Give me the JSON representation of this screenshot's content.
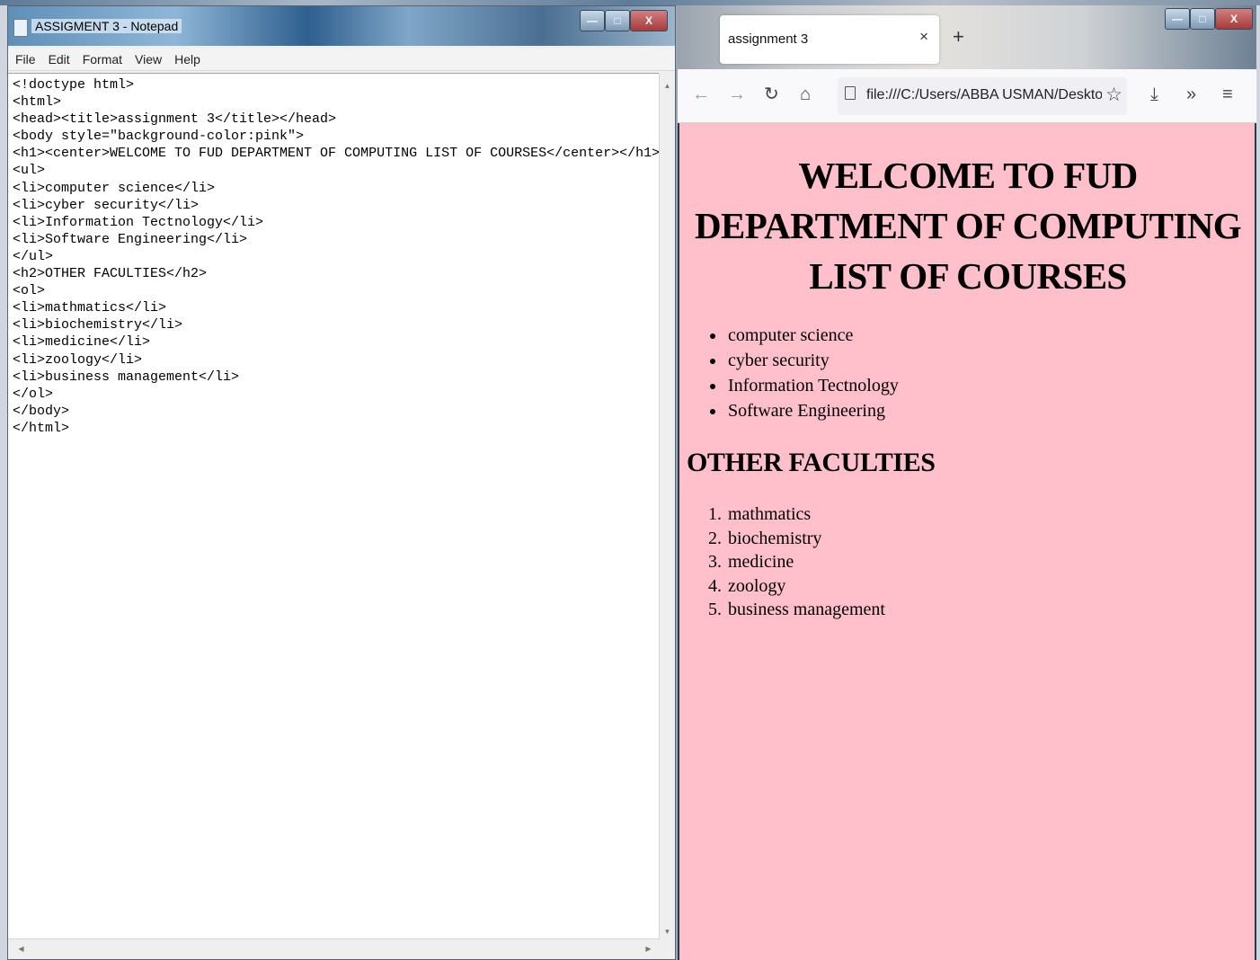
{
  "notepad": {
    "title": "ASSIGMENT 3 - Notepad",
    "menu": [
      "File",
      "Edit",
      "Format",
      "View",
      "Help"
    ],
    "code_lines": [
      "<!doctype html>",
      "<html>",
      "<head><title>assignment 3</title></head>",
      "<body style=\"background-color:pink\">",
      "<h1><center>WELCOME TO FUD DEPARTMENT OF COMPUTING LIST OF COURSES</center></h1>",
      "<ul>",
      "<li>computer science</li>",
      "<li>cyber security</li>",
      "<li>Information Tectnology</li>",
      "<li>Software Engineering</li>",
      "</ul>",
      "<h2>OTHER FACULTIES</h2>",
      "<ol>",
      "<li>mathmatics</li>",
      "<li>biochemistry</li>",
      "<li>medicine</li>",
      "<li>zoology</li>",
      "<li>business management</li>",
      "</ol>",
      "</body>",
      "</html>"
    ]
  },
  "window_buttons": {
    "minimize": "—",
    "maximize": "□",
    "close": "X"
  },
  "browser": {
    "tab_title": "assignment 3",
    "tab_close": "×",
    "new_tab": "+",
    "url": "file:///C:/Users/ABBA USMAN/Desktop",
    "icons": {
      "back": "←",
      "forward": "→",
      "reload": "↻",
      "home": "⌂",
      "bookmark": "☆",
      "download": "⤓",
      "overflow": "»",
      "menu": "≡"
    }
  },
  "page": {
    "heading": "WELCOME TO FUD DEPARTMENT OF COMPUTING LIST OF COURSES",
    "courses": [
      "computer science",
      "cyber security",
      "Information Tectnology",
      "Software Engineering"
    ],
    "subheading": "OTHER FACULTIES",
    "faculties": [
      "mathmatics",
      "biochemistry",
      "medicine",
      "zoology",
      "business management"
    ],
    "background_color": "#ffc0cb"
  }
}
